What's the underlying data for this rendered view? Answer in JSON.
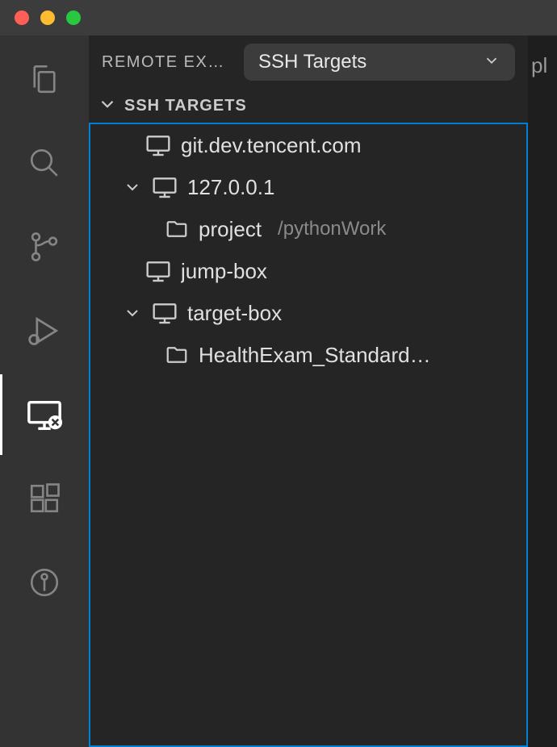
{
  "sidebar": {
    "title": "REMOTE EXP…",
    "dropdown": {
      "selected": "SSH Targets"
    },
    "section_title": "SSH TARGETS"
  },
  "tree": [
    {
      "indent": 1,
      "icon": "monitor",
      "label": "git.dev.tencent.com",
      "chevron": null
    },
    {
      "indent": 0,
      "icon": "monitor",
      "label": "127.0.0.1",
      "chevron": "down"
    },
    {
      "indent": 2,
      "icon": "folder",
      "label": "project",
      "desc": "/pythonWork"
    },
    {
      "indent": 1,
      "icon": "monitor",
      "label": "jump-box",
      "chevron": null
    },
    {
      "indent": 0,
      "icon": "monitor",
      "label": "target-box",
      "chevron": "down"
    },
    {
      "indent": 2,
      "icon": "folder",
      "label": "HealthExam_Standard…"
    }
  ],
  "right_partial": "pl"
}
